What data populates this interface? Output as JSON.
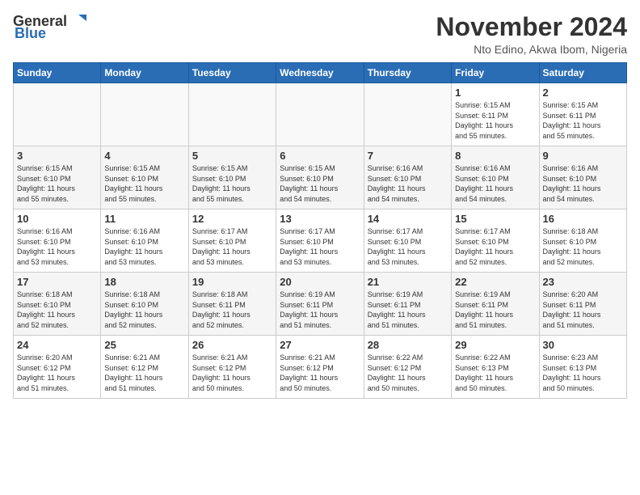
{
  "header": {
    "logo_general": "General",
    "logo_blue": "Blue",
    "month_title": "November 2024",
    "subtitle": "Nto Edino, Akwa Ibom, Nigeria"
  },
  "weekdays": [
    "Sunday",
    "Monday",
    "Tuesday",
    "Wednesday",
    "Thursday",
    "Friday",
    "Saturday"
  ],
  "weeks": [
    [
      {
        "day": "",
        "info": ""
      },
      {
        "day": "",
        "info": ""
      },
      {
        "day": "",
        "info": ""
      },
      {
        "day": "",
        "info": ""
      },
      {
        "day": "",
        "info": ""
      },
      {
        "day": "1",
        "info": "Sunrise: 6:15 AM\nSunset: 6:11 PM\nDaylight: 11 hours\nand 55 minutes."
      },
      {
        "day": "2",
        "info": "Sunrise: 6:15 AM\nSunset: 6:11 PM\nDaylight: 11 hours\nand 55 minutes."
      }
    ],
    [
      {
        "day": "3",
        "info": "Sunrise: 6:15 AM\nSunset: 6:10 PM\nDaylight: 11 hours\nand 55 minutes."
      },
      {
        "day": "4",
        "info": "Sunrise: 6:15 AM\nSunset: 6:10 PM\nDaylight: 11 hours\nand 55 minutes."
      },
      {
        "day": "5",
        "info": "Sunrise: 6:15 AM\nSunset: 6:10 PM\nDaylight: 11 hours\nand 55 minutes."
      },
      {
        "day": "6",
        "info": "Sunrise: 6:15 AM\nSunset: 6:10 PM\nDaylight: 11 hours\nand 54 minutes."
      },
      {
        "day": "7",
        "info": "Sunrise: 6:16 AM\nSunset: 6:10 PM\nDaylight: 11 hours\nand 54 minutes."
      },
      {
        "day": "8",
        "info": "Sunrise: 6:16 AM\nSunset: 6:10 PM\nDaylight: 11 hours\nand 54 minutes."
      },
      {
        "day": "9",
        "info": "Sunrise: 6:16 AM\nSunset: 6:10 PM\nDaylight: 11 hours\nand 54 minutes."
      }
    ],
    [
      {
        "day": "10",
        "info": "Sunrise: 6:16 AM\nSunset: 6:10 PM\nDaylight: 11 hours\nand 53 minutes."
      },
      {
        "day": "11",
        "info": "Sunrise: 6:16 AM\nSunset: 6:10 PM\nDaylight: 11 hours\nand 53 minutes."
      },
      {
        "day": "12",
        "info": "Sunrise: 6:17 AM\nSunset: 6:10 PM\nDaylight: 11 hours\nand 53 minutes."
      },
      {
        "day": "13",
        "info": "Sunrise: 6:17 AM\nSunset: 6:10 PM\nDaylight: 11 hours\nand 53 minutes."
      },
      {
        "day": "14",
        "info": "Sunrise: 6:17 AM\nSunset: 6:10 PM\nDaylight: 11 hours\nand 53 minutes."
      },
      {
        "day": "15",
        "info": "Sunrise: 6:17 AM\nSunset: 6:10 PM\nDaylight: 11 hours\nand 52 minutes."
      },
      {
        "day": "16",
        "info": "Sunrise: 6:18 AM\nSunset: 6:10 PM\nDaylight: 11 hours\nand 52 minutes."
      }
    ],
    [
      {
        "day": "17",
        "info": "Sunrise: 6:18 AM\nSunset: 6:10 PM\nDaylight: 11 hours\nand 52 minutes."
      },
      {
        "day": "18",
        "info": "Sunrise: 6:18 AM\nSunset: 6:10 PM\nDaylight: 11 hours\nand 52 minutes."
      },
      {
        "day": "19",
        "info": "Sunrise: 6:18 AM\nSunset: 6:11 PM\nDaylight: 11 hours\nand 52 minutes."
      },
      {
        "day": "20",
        "info": "Sunrise: 6:19 AM\nSunset: 6:11 PM\nDaylight: 11 hours\nand 51 minutes."
      },
      {
        "day": "21",
        "info": "Sunrise: 6:19 AM\nSunset: 6:11 PM\nDaylight: 11 hours\nand 51 minutes."
      },
      {
        "day": "22",
        "info": "Sunrise: 6:19 AM\nSunset: 6:11 PM\nDaylight: 11 hours\nand 51 minutes."
      },
      {
        "day": "23",
        "info": "Sunrise: 6:20 AM\nSunset: 6:11 PM\nDaylight: 11 hours\nand 51 minutes."
      }
    ],
    [
      {
        "day": "24",
        "info": "Sunrise: 6:20 AM\nSunset: 6:12 PM\nDaylight: 11 hours\nand 51 minutes."
      },
      {
        "day": "25",
        "info": "Sunrise: 6:21 AM\nSunset: 6:12 PM\nDaylight: 11 hours\nand 51 minutes."
      },
      {
        "day": "26",
        "info": "Sunrise: 6:21 AM\nSunset: 6:12 PM\nDaylight: 11 hours\nand 50 minutes."
      },
      {
        "day": "27",
        "info": "Sunrise: 6:21 AM\nSunset: 6:12 PM\nDaylight: 11 hours\nand 50 minutes."
      },
      {
        "day": "28",
        "info": "Sunrise: 6:22 AM\nSunset: 6:12 PM\nDaylight: 11 hours\nand 50 minutes."
      },
      {
        "day": "29",
        "info": "Sunrise: 6:22 AM\nSunset: 6:13 PM\nDaylight: 11 hours\nand 50 minutes."
      },
      {
        "day": "30",
        "info": "Sunrise: 6:23 AM\nSunset: 6:13 PM\nDaylight: 11 hours\nand 50 minutes."
      }
    ]
  ]
}
